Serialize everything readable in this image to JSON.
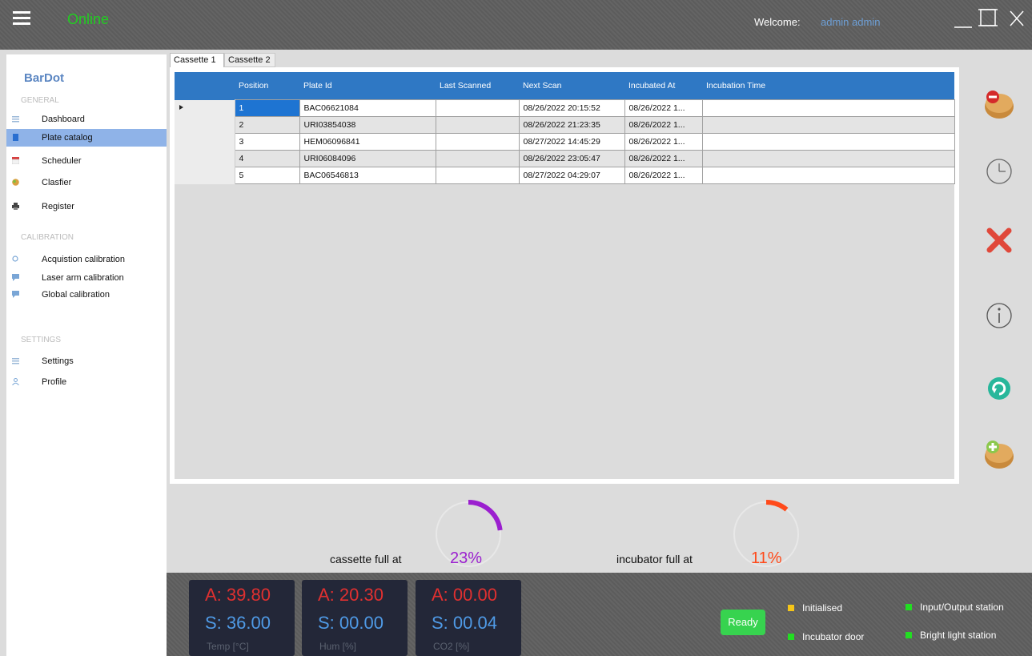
{
  "header": {
    "status": "Online",
    "welcome_label": "Welcome:",
    "user": "admin admin"
  },
  "sidebar": {
    "brand": "BarDot",
    "sections": {
      "general": "GENERAL",
      "calibration": "CALIBRATION",
      "settings": "SETTINGS"
    },
    "items": [
      {
        "label": "Dashboard"
      },
      {
        "label": "Plate catalog"
      },
      {
        "label": "Scheduler"
      },
      {
        "label": "Clasfier"
      },
      {
        "label": "Register"
      },
      {
        "label": "Acquistion calibration"
      },
      {
        "label": "Laser arm calibration"
      },
      {
        "label": "Global calibration"
      },
      {
        "label": "Settings"
      },
      {
        "label": "Profile"
      }
    ]
  },
  "tabs": [
    "Cassette 1",
    "Cassette 2"
  ],
  "table": {
    "headers": [
      "Position",
      "Plate Id",
      "Last Scanned",
      "Next Scan",
      "Incubated At",
      "Incubation Time"
    ],
    "rows": [
      [
        "1",
        "BAC06621084",
        "",
        "08/26/2022 20:15:52",
        "08/26/2022 1...",
        ""
      ],
      [
        "2",
        "URI03854038",
        "",
        "08/26/2022 21:23:35",
        "08/26/2022 1...",
        ""
      ],
      [
        "3",
        "HEM06096841",
        "",
        "08/27/2022 14:45:29",
        "08/26/2022 1...",
        ""
      ],
      [
        "4",
        "URI06084096",
        "",
        "08/26/2022 23:05:47",
        "08/26/2022 1...",
        ""
      ],
      [
        "5",
        "BAC06546813",
        "",
        "08/27/2022 04:29:07",
        "08/26/2022 1...",
        ""
      ]
    ]
  },
  "gauges": {
    "cassette": {
      "label": "cassette full at",
      "text": "23%",
      "value": 0.23,
      "color": "#9b1fcf"
    },
    "incubator": {
      "label": "incubator full at",
      "text": "11%",
      "value": 0.11,
      "color": "#ff4a1a"
    }
  },
  "sensors": [
    {
      "a": "A: 39.80",
      "s": "S: 36.00",
      "unit": "Temp [°C]"
    },
    {
      "a": "A: 20.30",
      "s": "S: 00.00",
      "unit": "Hum [%]"
    },
    {
      "a": "A: 00.00",
      "s": "S: 00.04",
      "unit": "CO2 [%]"
    }
  ],
  "status": {
    "ready": "Ready",
    "indicators": [
      {
        "label": "Initialised",
        "color": "#f5c518"
      },
      {
        "label": "Incubator door",
        "color": "#22dd22"
      },
      {
        "label": "Input/Output station",
        "color": "#22dd22"
      },
      {
        "label": "Bright light station",
        "color": "#22dd22"
      }
    ]
  },
  "colors": {
    "accent": "#2f78c4",
    "selected_nav": "#8fb3e8"
  }
}
